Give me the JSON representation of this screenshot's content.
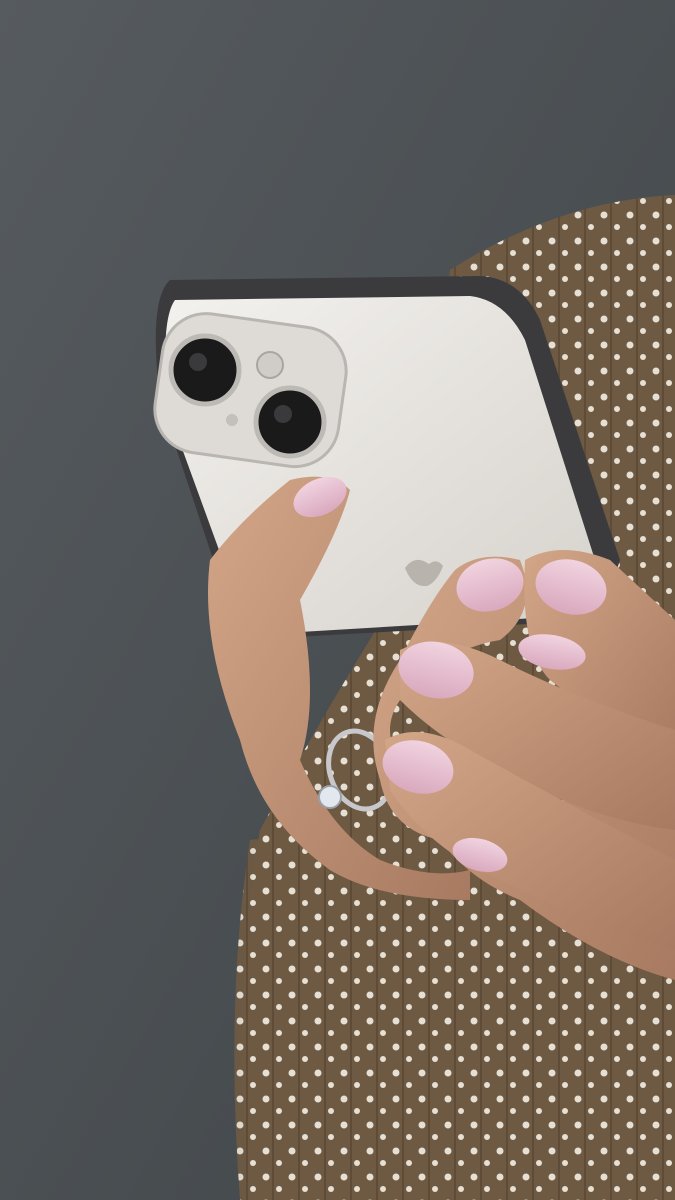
{
  "colors": {
    "background": "#4b5054",
    "sweater": "#6e5a43",
    "sweater_dots": "#e8e2d8",
    "phone_body": "#e9e6e1",
    "phone_edge": "#3b3b3d",
    "camera_lens": "#141414",
    "skin": "#c99a7e",
    "skin_shadow": "#9c6f58",
    "nail": "#e9c6d6",
    "ring": "#c8c8cc"
  }
}
